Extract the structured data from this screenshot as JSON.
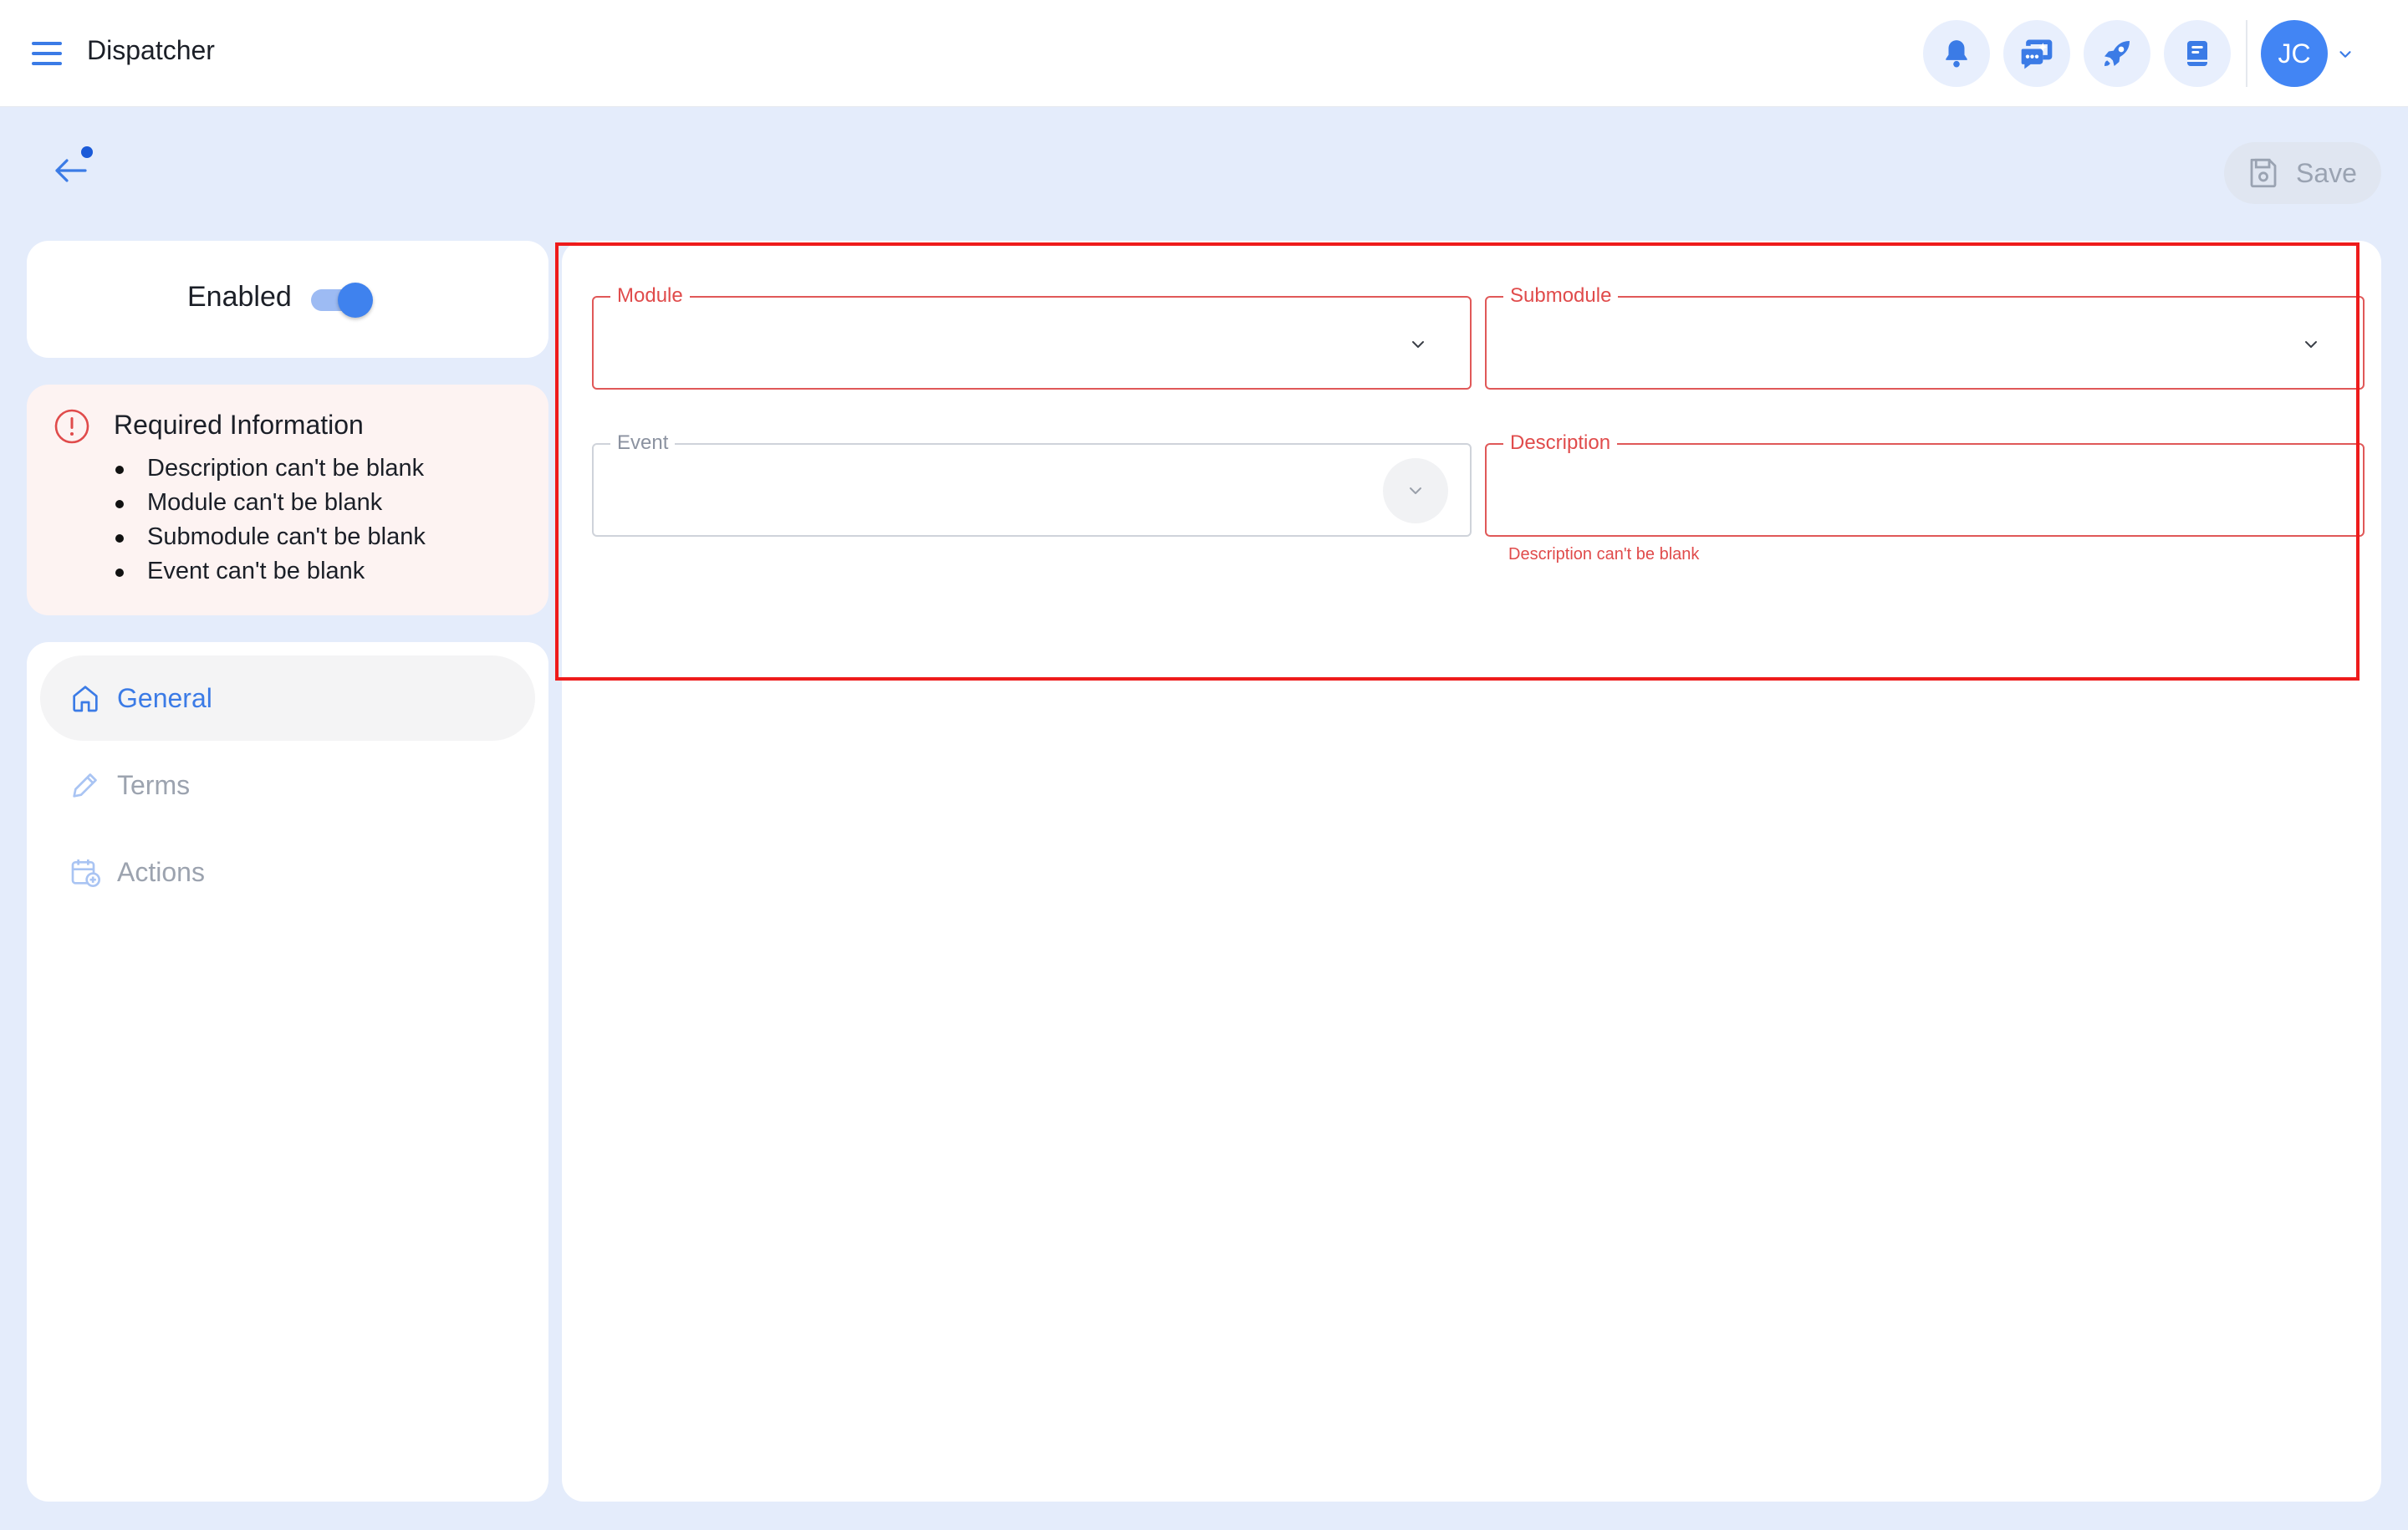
{
  "header": {
    "title": "Dispatcher",
    "icons": [
      "bell-icon",
      "chat-sparkle-icon",
      "rocket-icon",
      "notebook-icon"
    ],
    "avatar_initials": "JC"
  },
  "toolbar": {
    "save_label": "Save"
  },
  "status": {
    "enabled_label": "Enabled",
    "enabled": true
  },
  "required_info": {
    "title": "Required Information",
    "items": [
      "Description can't be blank",
      "Module can't be blank",
      "Submodule can't be blank",
      "Event can't be blank"
    ]
  },
  "nav": {
    "items": [
      {
        "label": "General",
        "icon": "home-icon",
        "active": true
      },
      {
        "label": "Terms",
        "icon": "pencil-icon",
        "active": false
      },
      {
        "label": "Actions",
        "icon": "calendar-plus-icon",
        "active": false
      }
    ]
  },
  "form": {
    "module": {
      "label": "Module",
      "value": ""
    },
    "submodule": {
      "label": "Submodule",
      "value": ""
    },
    "event": {
      "label": "Event",
      "value": ""
    },
    "description": {
      "label": "Description",
      "value": "",
      "error": "Description can't be blank"
    }
  },
  "colors": {
    "accent": "#3b7be6",
    "error": "#e04b4b",
    "background": "#e4ecfb",
    "highlight": "#ee1b1b"
  }
}
